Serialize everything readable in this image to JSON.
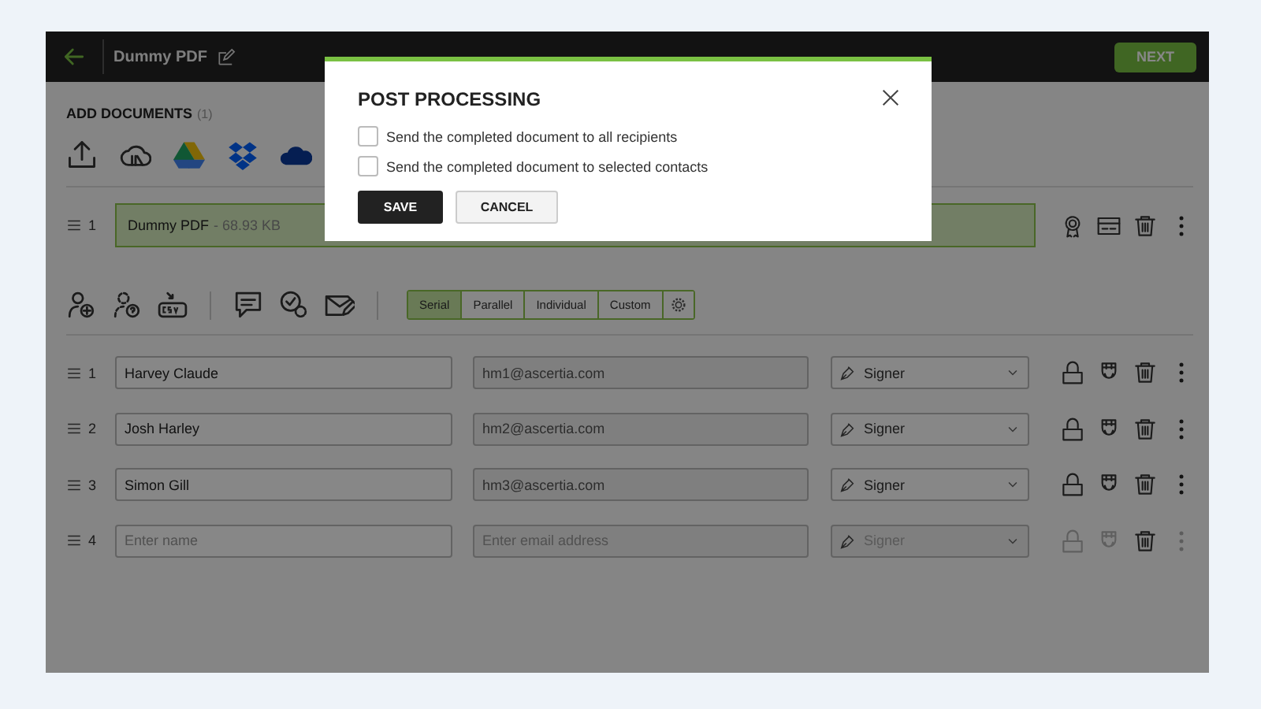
{
  "header": {
    "title": "Dummy PDF",
    "next_button": "NEXT"
  },
  "documents": {
    "heading": "ADD DOCUMENTS",
    "count": "(1)",
    "files": [
      {
        "number": "1",
        "name": "Dummy PDF",
        "size": "- 68.93 KB"
      }
    ]
  },
  "signing_modes": [
    {
      "label": "Serial",
      "selected": true
    },
    {
      "label": "Parallel",
      "selected": false
    },
    {
      "label": "Individual",
      "selected": false
    },
    {
      "label": "Custom",
      "selected": false
    }
  ],
  "recipients": [
    {
      "number": "1",
      "name": {
        "value": "Harvey Claude"
      },
      "email": {
        "value": "hm1@ascertia.com"
      },
      "role": "Signer",
      "disabled": false
    },
    {
      "number": "2",
      "name": {
        "value": "Josh Harley"
      },
      "email": {
        "value": "hm2@ascertia.com"
      },
      "role": "Signer",
      "disabled": false
    },
    {
      "number": "3",
      "name": {
        "value": "Simon Gill"
      },
      "email": {
        "value": "hm3@ascertia.com"
      },
      "role": "Signer",
      "disabled": false
    },
    {
      "number": "4",
      "name": {
        "placeholder": "Enter name"
      },
      "email": {
        "placeholder": "Enter email address"
      },
      "role": "Signer",
      "disabled": true
    }
  ],
  "dialog": {
    "title": "POST PROCESSING",
    "options": [
      {
        "label": "Send the completed document to all recipients",
        "checked": false
      },
      {
        "label": "Send the completed document to selected contacts",
        "checked": false
      }
    ],
    "buttons": [
      {
        "label": "SAVE",
        "kind": "primary"
      },
      {
        "label": "CANCEL",
        "kind": "secondary"
      }
    ]
  }
}
